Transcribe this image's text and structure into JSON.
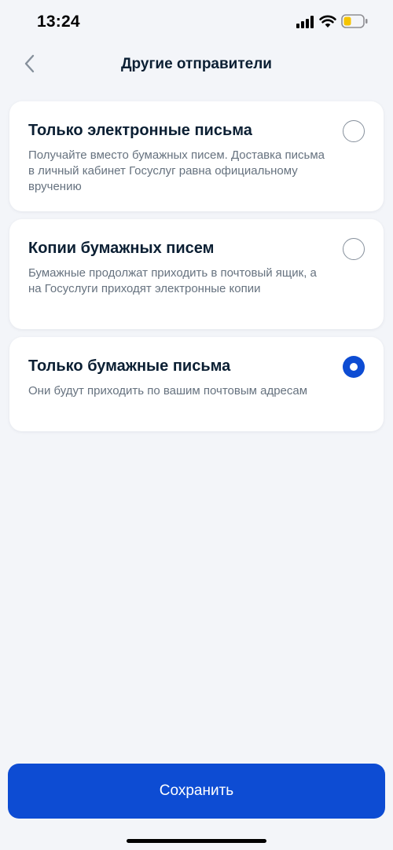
{
  "status_bar": {
    "time": "13:24",
    "battery_color": "#f5c400"
  },
  "header": {
    "title": "Другие отправители",
    "back_icon": "chevron-left-icon"
  },
  "options": [
    {
      "title": "Только электронные письма",
      "description": "Получайте вместо бумажных писем. Доставка письма в личный кабинет Госуслуг равна официальному вручению",
      "selected": false
    },
    {
      "title": "Копии бумажных писем",
      "description": "Бумажные продолжат приходить в почтовый ящик, а на Госуслуги приходят электронные копии",
      "selected": false
    },
    {
      "title": "Только бумажные письма",
      "description": "Они будут приходить по вашим почтовым адресам",
      "selected": true
    }
  ],
  "footer": {
    "save_label": "Сохранить"
  },
  "colors": {
    "accent": "#0d4cd3",
    "background": "#f3f5f9",
    "title_text": "#0b1f33",
    "secondary_text": "#66727f"
  }
}
